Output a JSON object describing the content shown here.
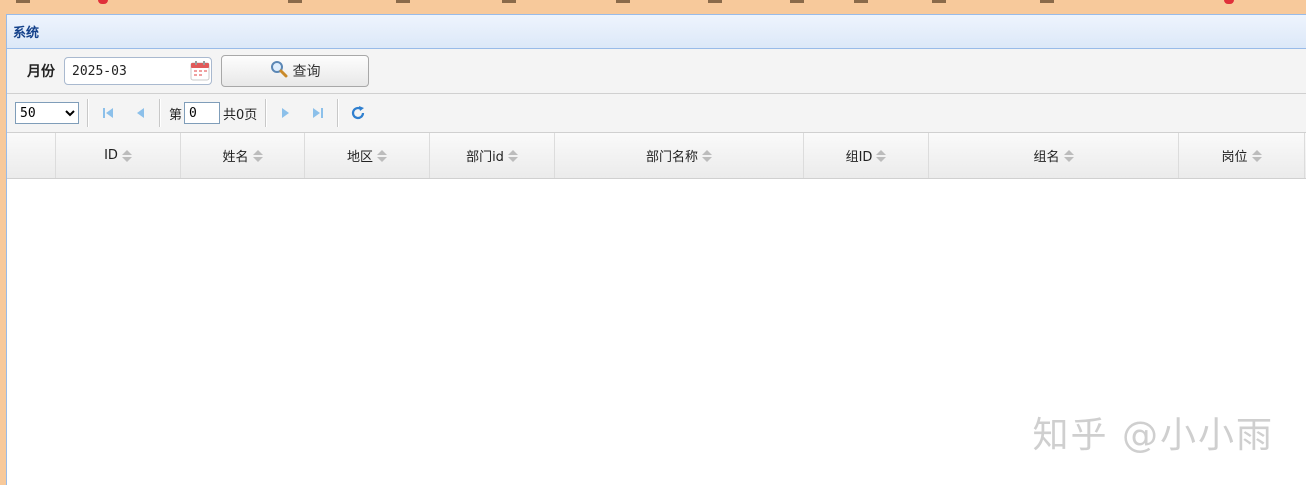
{
  "panel": {
    "title": "系统"
  },
  "toolbar": {
    "month_label": "月份",
    "month_value": "2025-03",
    "query_label": "查询"
  },
  "pager": {
    "page_size": "50",
    "page_size_options": [
      "50"
    ],
    "page_prefix": "第",
    "page_value": "0",
    "page_total": "共0页"
  },
  "grid": {
    "columns": [
      "ID",
      "姓名",
      "地区",
      "部门id",
      "部门名称",
      "组ID",
      "组名",
      "岗位"
    ]
  },
  "watermark": "知乎 @小小雨",
  "colors": {
    "accent": "#15428b",
    "header_border": "#99bbe8",
    "pager_icon": "#3a8fd8"
  }
}
